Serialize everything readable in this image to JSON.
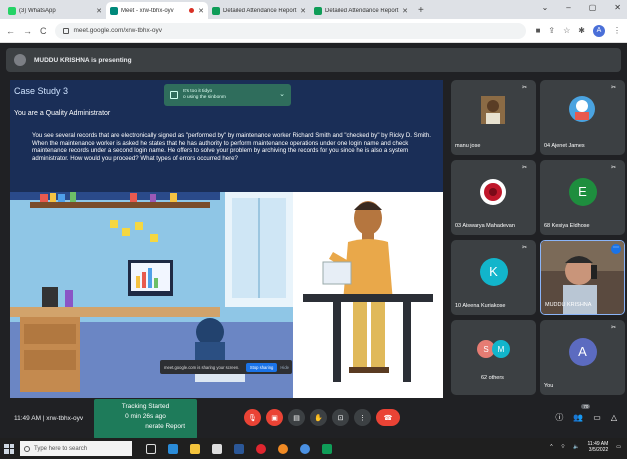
{
  "browser": {
    "tabs": [
      {
        "title": "(3) WhatsApp",
        "color": "#25d366",
        "active": false,
        "recording": false
      },
      {
        "title": "Meet - xrw-tbhx-oyv",
        "color": "#00897b",
        "active": true,
        "recording": true
      },
      {
        "title": "Detailed Attendance Report | G...",
        "color": "#0f9d58",
        "active": false,
        "recording": false
      },
      {
        "title": "Detailed Attendance Report | Go...",
        "color": "#0f9d58",
        "active": false,
        "recording": false
      }
    ],
    "new_tab": "+",
    "window_controls": [
      "⌄",
      "–",
      "▢",
      "✕"
    ],
    "url": "meet.google.com/xrw-tbhx-oyv",
    "nav": [
      "←",
      "→",
      "C"
    ]
  },
  "meet": {
    "presenter_banner": "MUDDU KRISHNA is presenting",
    "slide": {
      "title": "Case Study 3",
      "role": "You are a Quality Administrator",
      "body": "You see several records that are electronically signed as \"performed by\" by maintenance worker Richard Smith and \"checked by\" by Ricky D. Smith. When the maintenance worker is asked he states that he has authority to perform maintenance operations under one login name and check maintenance records under a second login name. He offers to solve your problem by archiving the records for you since he is also a system administrator. How would you proceed? What types of errors occurred here?",
      "notice_line1": "It's too it tidyo",
      "notice_line2": "o using the sinbonm",
      "sharing_text": "meet.google.com is sharing your screen.",
      "stop_sharing": "Stop sharing",
      "hide": "Hide"
    },
    "participants": [
      {
        "name": "manu jose",
        "type": "photo"
      },
      {
        "name": "04 Ajenet James",
        "type": "photo"
      },
      {
        "name": "03 Aiswarya Mahadevan",
        "type": "photo"
      },
      {
        "name": "68 Kesiya Eldhose",
        "type": "initial",
        "initial": "E",
        "color": "#1e8e3e"
      },
      {
        "name": "10 Aleena Kuriakose",
        "type": "initial",
        "initial": "K",
        "color": "#12b5cb"
      },
      {
        "name": "MUDDU KRISHNA",
        "type": "photo"
      },
      {
        "name": "62 others",
        "type": "group",
        "initials": [
          "S",
          "M"
        ]
      },
      {
        "name": "You",
        "type": "initial",
        "initial": "A",
        "color": "#5c6bc0"
      }
    ],
    "time_code": "11:49 AM | xrw-tbhx-oyv",
    "tracking": {
      "line1": "Tracking Started",
      "line2": "0 min 26s ago",
      "line3": "nerate Report"
    },
    "participant_count": "70"
  },
  "taskbar": {
    "search_placeholder": "Type here to search",
    "time": "11:49 AM",
    "date": "3/5/2022"
  }
}
